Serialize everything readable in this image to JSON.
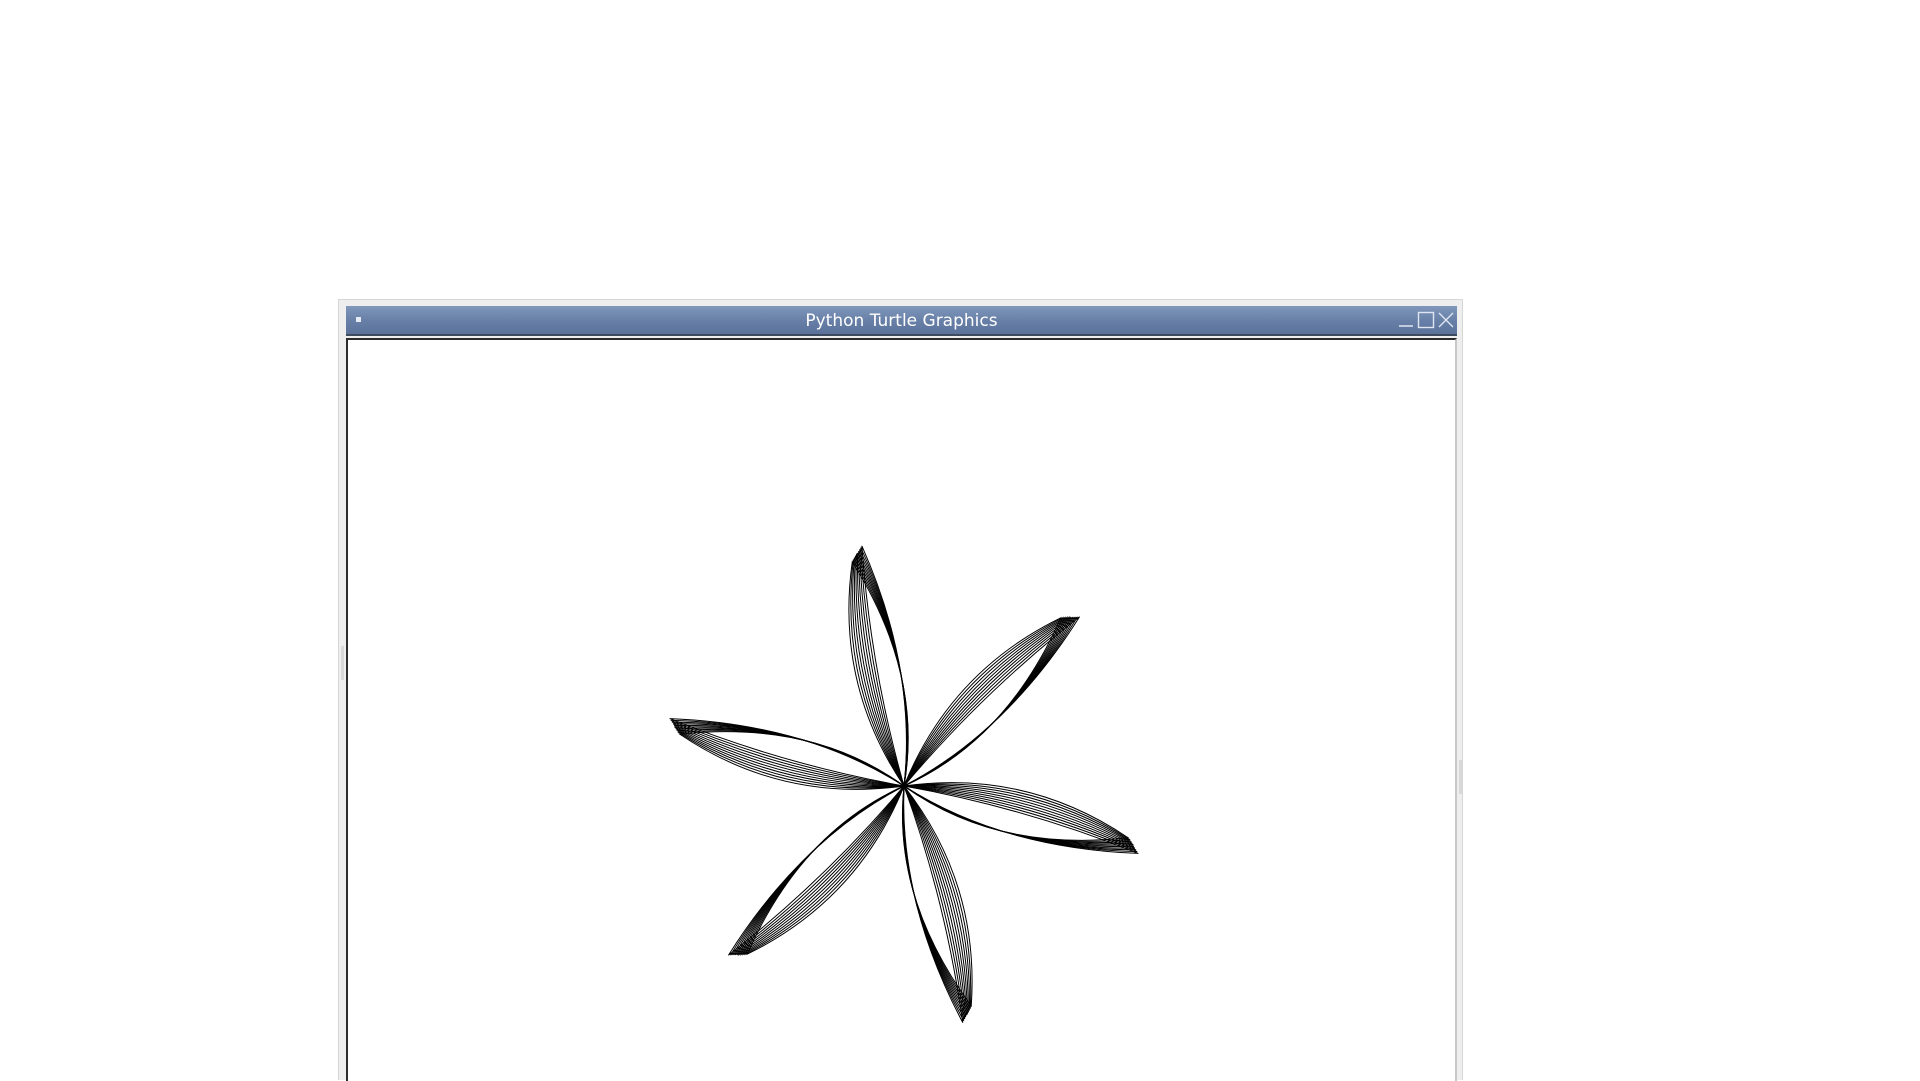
{
  "window": {
    "title": "Python Turtle Graphics",
    "titlebar_color": "#6981a8",
    "title_text_color": "#ffffff"
  },
  "titlebar_buttons": {
    "menu_icon": "window-menu-icon",
    "minimize_icon": "minimize-icon",
    "maximize_icon": "maximize-icon",
    "close_icon": "close-icon"
  },
  "drawing": {
    "petal_count": 6,
    "strokes_per_petal": 10,
    "pen_color": "#000000",
    "background": "#ffffff"
  }
}
